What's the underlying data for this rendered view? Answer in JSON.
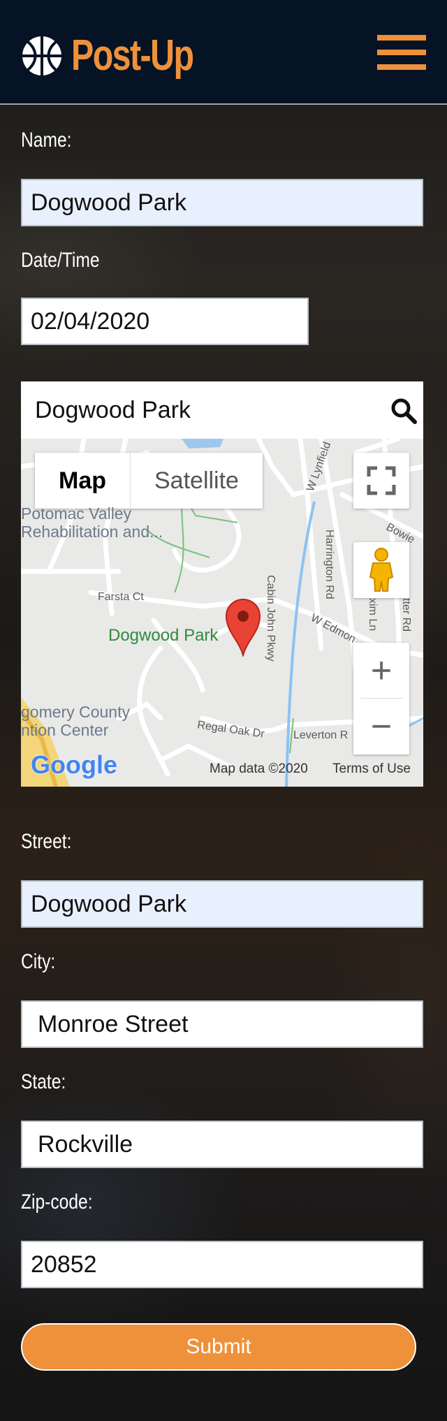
{
  "header": {
    "brand": "Post-Up",
    "logo_icon": "basketball-icon",
    "menu_icon": "hamburger-menu-icon",
    "brand_color": "#ef913a",
    "header_bg": "#061325"
  },
  "form": {
    "name_label": "Name:",
    "name_value": "Dogwood Park",
    "date_label": "Date/Time",
    "date_value": "02/04/2020",
    "street_label": "Street:",
    "street_value": "Dogwood Park",
    "city_label": "City:",
    "city_value": "Monroe Street",
    "state_label": "State:",
    "state_value": "Rockville",
    "zip_label": "Zip-code:",
    "zip_value": "20852",
    "submit_label": "Submit"
  },
  "map": {
    "search_value": "Dogwood Park",
    "search_icon": "search-icon",
    "map_type_map": "Map",
    "map_type_satellite": "Satellite",
    "fullscreen_icon": "fullscreen-icon",
    "pegman_icon": "street-view-pegman-icon",
    "zoom_in": "+",
    "zoom_out": "−",
    "marker_label": "Dogwood Park",
    "poi_1_line1": "Potomac Valley",
    "poi_1_line2": "Rehabilitation and...",
    "poi_2_line1": "gomery County",
    "poi_2_line2": "ntion Center",
    "street_farsta": "Farsta Ct",
    "street_regal": "Regal Oak Dr",
    "street_leverton": "Leverton R",
    "street_cabin": "Cabin John Pkwy",
    "street_harrington": "Harrington Rd",
    "street_edmonds": "W Edmon",
    "street_lynfield": "W Lynfield",
    "street_bowie": "Bowie",
    "street_sxim": "xim Ln",
    "street_tter": "tter Rd",
    "google_logo": "Google",
    "map_data": "Map data ©2020",
    "terms": "Terms of Use"
  }
}
